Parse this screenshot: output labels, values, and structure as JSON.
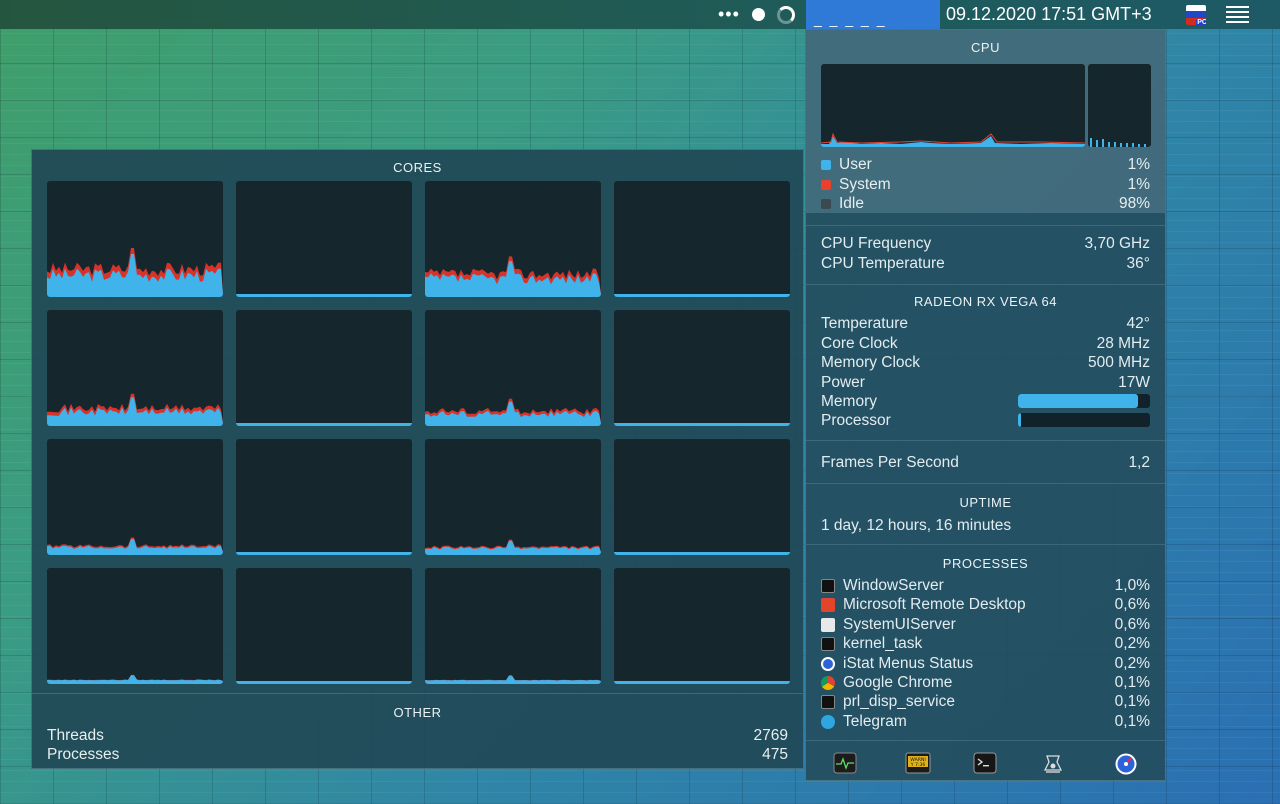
{
  "menubar": {
    "more": "•••",
    "cpu_indicator": "_ _ _ _ _",
    "clock": "09.12.2020 17:51 GMT+3",
    "input_badge": "PC"
  },
  "cores": {
    "title": "CORES",
    "other_title": "OTHER",
    "threads_label": "Threads",
    "threads_value": "2769",
    "processes_label": "Processes",
    "processes_value": "475"
  },
  "cpu": {
    "title": "CPU",
    "legend": [
      {
        "label": "User",
        "value": "1%",
        "color": "#3fb3ea"
      },
      {
        "label": "System",
        "value": "1%",
        "color": "#e8412c"
      },
      {
        "label": "Idle",
        "value": "98%",
        "color": "#3a4a50"
      }
    ],
    "frequency_label": "CPU Frequency",
    "frequency_value": "3,70 GHz",
    "temperature_label": "CPU Temperature",
    "temperature_value": "36°"
  },
  "gpu": {
    "title": "RADEON RX VEGA 64",
    "rows": [
      {
        "label": "Temperature",
        "value": "42°"
      },
      {
        "label": "Core Clock",
        "value": "28 MHz"
      },
      {
        "label": "Memory Clock",
        "value": "500 MHz"
      },
      {
        "label": "Power",
        "value": "17W"
      }
    ],
    "memory_label": "Memory",
    "memory_level": 0.91,
    "processor_label": "Processor",
    "processor_level": 0.02,
    "fps_label": "Frames Per Second",
    "fps_value": "1,2"
  },
  "uptime": {
    "title": "UPTIME",
    "value": "1 day, 12 hours, 16 minutes"
  },
  "processes": {
    "title": "PROCESSES",
    "items": [
      {
        "name": "WindowServer",
        "value": "1,0%",
        "icon": "terminal-icon"
      },
      {
        "name": "Microsoft Remote Desktop",
        "value": "0,6%",
        "icon": "remote-desktop-icon"
      },
      {
        "name": "SystemUIServer",
        "value": "0,6%",
        "icon": "document-icon"
      },
      {
        "name": "kernel_task",
        "value": "0,2%",
        "icon": "terminal-icon"
      },
      {
        "name": "iStat Menus Status",
        "value": "0,2%",
        "icon": "istat-icon"
      },
      {
        "name": "Google Chrome",
        "value": "0,1%",
        "icon": "chrome-icon"
      },
      {
        "name": "prl_disp_service",
        "value": "0,1%",
        "icon": "terminal-icon"
      },
      {
        "name": "Telegram",
        "value": "0,1%",
        "icon": "telegram-icon"
      }
    ]
  },
  "footer": {
    "console_badge": "WARNI\nY 7:36"
  }
}
